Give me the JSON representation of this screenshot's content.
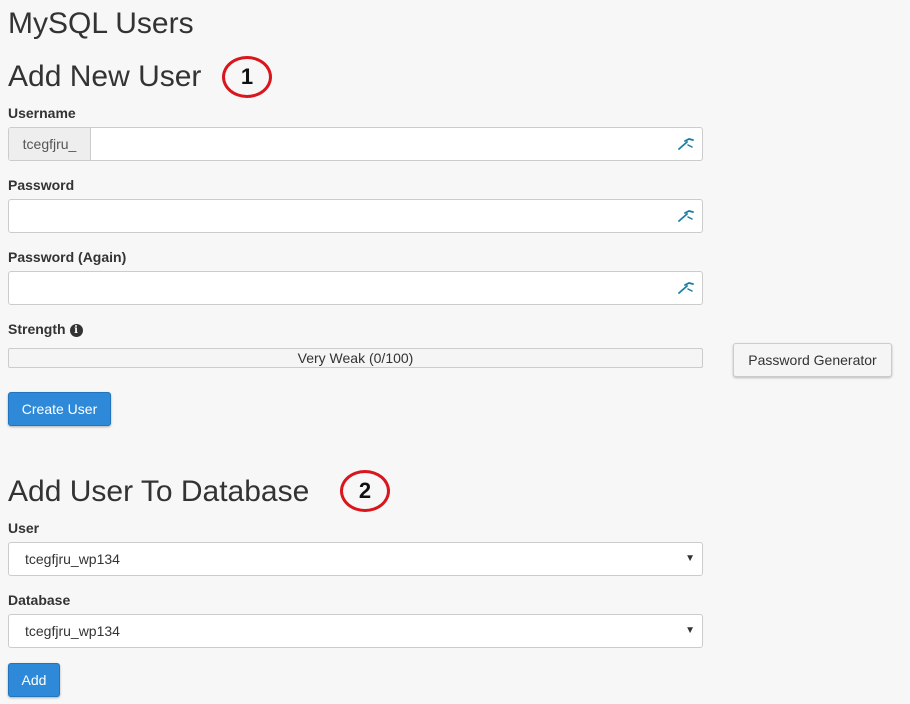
{
  "page": {
    "title": "MySQL Users"
  },
  "add_user": {
    "heading": "Add New User",
    "badge": "1",
    "username_label": "Username",
    "username_prefix": "tcegfjru_",
    "username_value": "",
    "password_label": "Password",
    "password_value": "",
    "password_again_label": "Password (Again)",
    "password_again_value": "",
    "strength_label": "Strength",
    "strength_text": "Very Weak (0/100)",
    "strength_score": 0,
    "password_generator_label": "Password Generator",
    "create_user_label": "Create User",
    "icons": {
      "field_icon": "key-icon",
      "info": "info-icon"
    }
  },
  "add_to_db": {
    "heading": "Add User To Database",
    "badge": "2",
    "user_label": "User",
    "user_selected": "tcegfjru_wp134",
    "database_label": "Database",
    "database_selected": "tcegfjru_wp134",
    "add_label": "Add"
  },
  "colors": {
    "primary": "#2e8ad8",
    "badge_ring": "#d9161c",
    "background": "#f7f7f7"
  }
}
